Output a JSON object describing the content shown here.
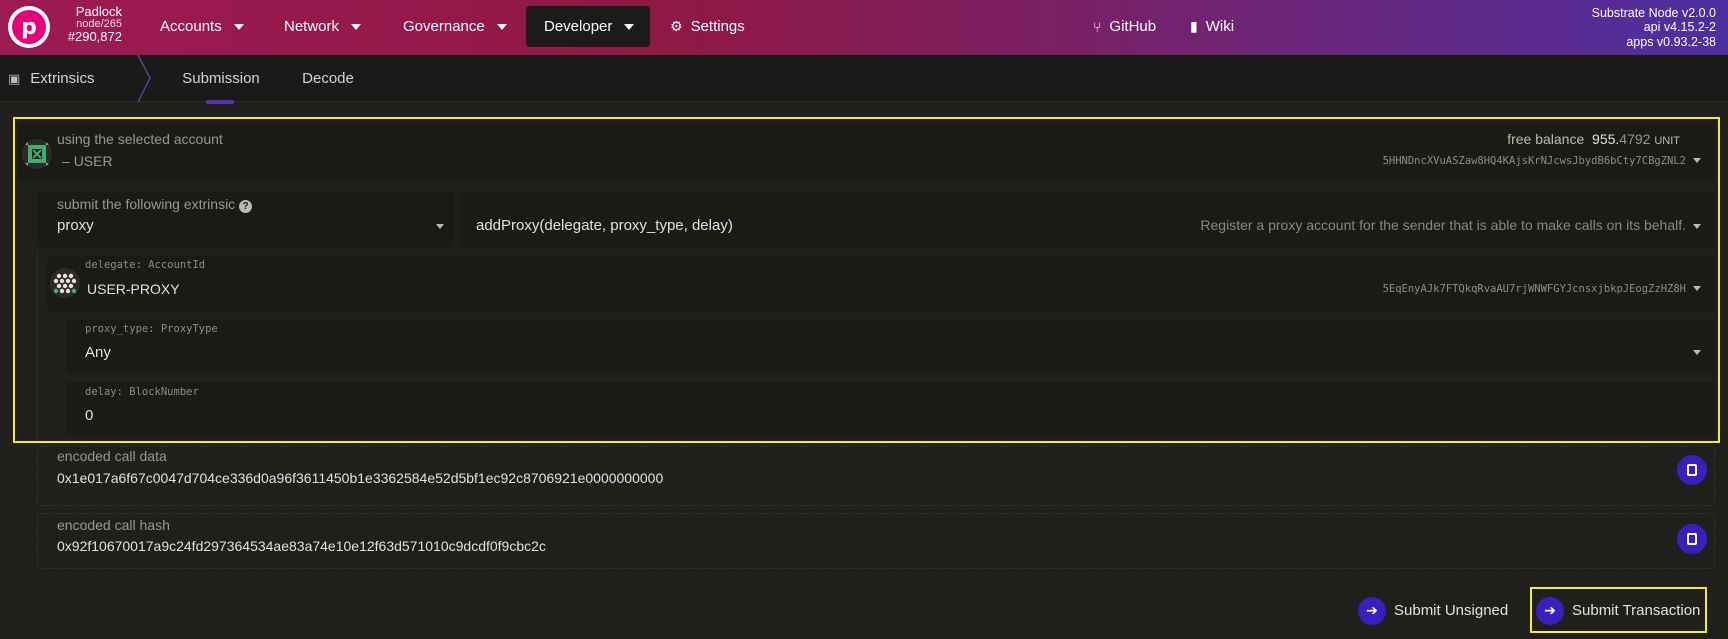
{
  "chain": {
    "name": "Padlock",
    "node": "node/265",
    "block": "#290,872",
    "logo_letter": "p"
  },
  "nav": {
    "accounts": "Accounts",
    "network": "Network",
    "governance": "Governance",
    "developer": "Developer",
    "settings": "Settings",
    "github": "GitHub",
    "wiki": "Wiki"
  },
  "node_info": {
    "line1": "Substrate Node v2.0.0",
    "line2": "api v4.15.2-2",
    "line3": "apps v0.93.2-38"
  },
  "tabs": {
    "section": "Extrinsics",
    "submission": "Submission",
    "decode": "Decode"
  },
  "account": {
    "label": "using the selected account",
    "name": "USER",
    "address": "5HHNDncXVuASZaw8HQ4KAjsKrNJcwsJbydB6bCty7CBgZNL2",
    "balance_label": "free balance",
    "balance_int": "955.",
    "balance_dec": "4792",
    "balance_unit": "UNIT"
  },
  "extrinsic": {
    "label": "submit the following extrinsic",
    "module": "proxy",
    "method": "addProxy(delegate, proxy_type, delay)",
    "description": "Register a proxy account for the sender that is able to make calls on its behalf."
  },
  "params": {
    "delegate_label": "delegate: AccountId",
    "delegate_name": "USER-PROXY",
    "delegate_address": "5EqEnyAJk7FTQkqRvaAU7rjWNWFGYJcnsxjbkpJEogZzHZ8H",
    "proxy_type_label": "proxy_type: ProxyType",
    "proxy_type_value": "Any",
    "delay_label": "delay: BlockNumber",
    "delay_value": "0"
  },
  "encoded": {
    "call_data_label": "encoded call data",
    "call_data": "0x1e017a6f67c0047d704ce336d0a96f3611450b1e3362584e52d5bf1ec92c8706921e0000000000",
    "call_hash_label": "encoded call hash",
    "call_hash": "0x92f10670017a9c24fd297364534ae83a74e10e12f63d571010c9dcdf0f9cbc2c"
  },
  "actions": {
    "unsigned": "Submit Unsigned",
    "transaction": "Submit Transaction"
  },
  "colors": {
    "accent": "#3a1fbf",
    "highlight": "#f5ec3a",
    "background": "#211f1c"
  }
}
